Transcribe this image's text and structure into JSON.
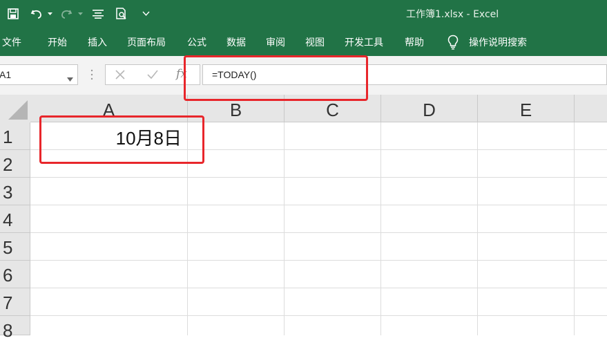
{
  "titlebar": {
    "document_title": "工作簿1.xlsx  -  Excel",
    "quick_access": [
      {
        "name": "save",
        "icon": "save-icon"
      },
      {
        "name": "undo",
        "icon": "undo-icon"
      },
      {
        "name": "redo",
        "icon": "redo-icon"
      },
      {
        "name": "align",
        "icon": "align-icon"
      },
      {
        "name": "print-preview",
        "icon": "print-preview-icon"
      },
      {
        "name": "customize",
        "icon": "chevron-down-icon"
      }
    ]
  },
  "ribbon": {
    "tabs": [
      "文件",
      "开始",
      "插入",
      "页面布局",
      "公式",
      "数据",
      "审阅",
      "视图",
      "开发工具",
      "帮助"
    ],
    "tell_me": "操作说明搜索"
  },
  "formula_bar": {
    "name_box": "A1",
    "formula": "=TODAY()",
    "fx_label": "fx"
  },
  "sheet": {
    "columns": [
      "A",
      "B",
      "C",
      "D",
      "E"
    ],
    "rows": [
      "1",
      "2",
      "3",
      "4",
      "5",
      "6",
      "7",
      "8"
    ],
    "cells": {
      "A1": "10月8日"
    }
  },
  "annotations": {
    "highlight_color": "#e8262b"
  },
  "colors": {
    "brand": "#217346"
  }
}
